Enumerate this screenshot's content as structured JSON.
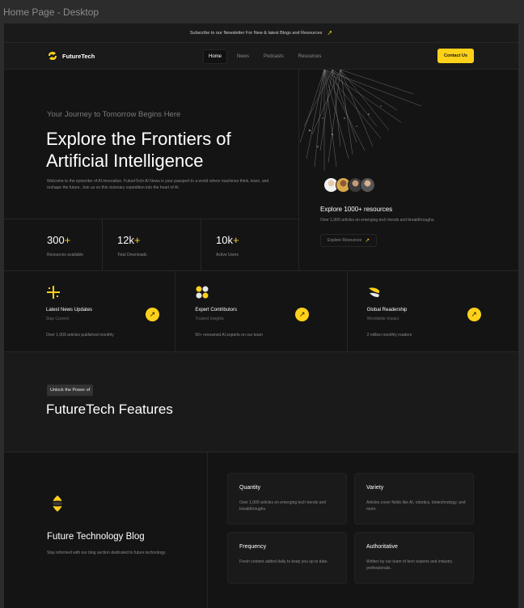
{
  "frame_label": "Home Page - Desktop",
  "banner": {
    "text": "Subscribe to our Newsletter For New & latest Blogs and Resources",
    "arrow": "↗"
  },
  "nav": {
    "brand": "FutureTech",
    "links": [
      "Home",
      "News",
      "Podcasts",
      "Resources"
    ],
    "contact": "Contact Us"
  },
  "hero": {
    "tagline": "Your Journey to Tomorrow Begins Here",
    "title_line1": "Explore the Frontiers of",
    "title_line2": "Artificial Intelligence",
    "description": "Welcome to the epicenter of AI innovation. FutureTech AI News is your passport to a world where machines think, learn, and reshape the future. Join us on this visionary expedition into the heart of AI.",
    "stats": [
      {
        "value": "300",
        "plus": "+",
        "label": "Resources available"
      },
      {
        "value": "12k",
        "plus": "+",
        "label": "Total Downloads"
      },
      {
        "value": "10k",
        "plus": "+",
        "label": "Active Users"
      }
    ],
    "resources": {
      "title": "Explore 1000+ resources",
      "description": "Over 1,000 articles on emerging tech trends and breakthroughs.",
      "button": "Explore Resources",
      "arrow": "↗"
    }
  },
  "features_row": [
    {
      "title": "Latest News Updates",
      "subtitle": "Stay Current",
      "desc": "Over 1,000 articles published monthly",
      "icon": "sparkle-icon"
    },
    {
      "title": "Expert Contributors",
      "subtitle": "Trusted Insights",
      "desc": "50+ renowned AI experts on our team",
      "icon": "dots-icon"
    },
    {
      "title": "Global Readership",
      "subtitle": "Worldwide Impact",
      "desc": "2 million monthly readers",
      "icon": "leaf-icon"
    }
  ],
  "section": {
    "pill": "Unlock the Power of",
    "title": "FutureTech Features"
  },
  "blog": {
    "title": "Future Technology Blog",
    "description": "Stay informed with our blog section dedicated to future technology.",
    "cards": [
      {
        "title": "Quantity",
        "desc": "Over 1,000 articles on emerging tech trends and breakthroughs."
      },
      {
        "title": "Variety",
        "desc": "Articles cover fields like AI, robotics, biotechnology, and more."
      },
      {
        "title": "Frequency",
        "desc": "Fresh content added daily to keep you up to date."
      },
      {
        "title": "Authoritative",
        "desc": "Written by our team of tech experts and industry professionals."
      }
    ]
  },
  "colors": {
    "accent": "#ffd11a",
    "background": "#141414",
    "panel": "#1a1a1a",
    "border": "#262626"
  }
}
